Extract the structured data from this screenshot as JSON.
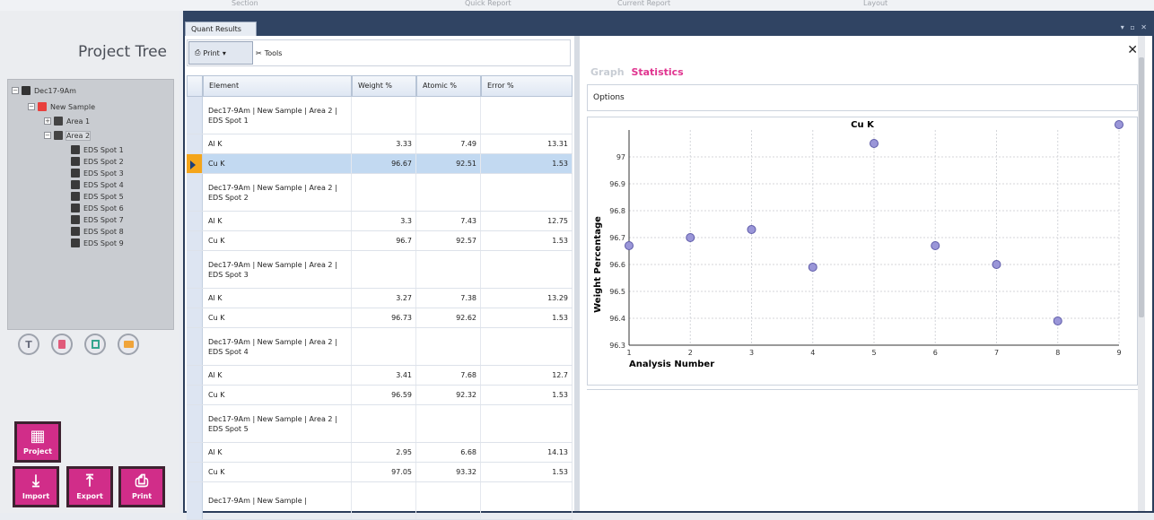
{
  "topbar": {
    "items": [
      "Section",
      "Quick Report",
      "Current Report",
      "Layout"
    ]
  },
  "left_panel": {
    "title": "Project Tree",
    "tree": {
      "root": "Dec17-9Am",
      "sample": "New Sample",
      "areas": [
        "Area 1",
        "Area 2"
      ],
      "spots": [
        "EDS Spot 1",
        "EDS Spot 2",
        "EDS Spot 3",
        "EDS Spot 4",
        "EDS Spot 5",
        "EDS Spot 6",
        "EDS Spot 7",
        "EDS Spot 8",
        "EDS Spot 9"
      ]
    },
    "circle_buttons": [
      "T",
      "trash-icon",
      "report-icon",
      "folder-icon"
    ],
    "buttons": {
      "project": "Project",
      "import": "Import",
      "export": "Export",
      "print": "Print"
    }
  },
  "window": {
    "tab": "Quant Results",
    "toolbar": {
      "print": "Print",
      "tools": "Tools"
    },
    "table": {
      "headers": [
        "Element",
        "Weight %",
        "Atomic %",
        "Error %"
      ],
      "rows": [
        {
          "type": "group",
          "label": "Dec17-9Am | New Sample | Area 2 | EDS Spot 1"
        },
        {
          "type": "data",
          "el": "Al K",
          "w": "3.33",
          "a": "7.49",
          "e": "13.31"
        },
        {
          "type": "data",
          "el": "Cu K",
          "w": "96.67",
          "a": "92.51",
          "e": "1.53",
          "selected": true
        },
        {
          "type": "group",
          "label": "Dec17-9Am | New Sample | Area 2 | EDS Spot 2"
        },
        {
          "type": "data",
          "el": "Al K",
          "w": "3.3",
          "a": "7.43",
          "e": "12.75"
        },
        {
          "type": "data",
          "el": "Cu K",
          "w": "96.7",
          "a": "92.57",
          "e": "1.53"
        },
        {
          "type": "group",
          "label": "Dec17-9Am | New Sample | Area 2 | EDS Spot 3"
        },
        {
          "type": "data",
          "el": "Al K",
          "w": "3.27",
          "a": "7.38",
          "e": "13.29"
        },
        {
          "type": "data",
          "el": "Cu K",
          "w": "96.73",
          "a": "92.62",
          "e": "1.53"
        },
        {
          "type": "group",
          "label": "Dec17-9Am | New Sample | Area 2 | EDS Spot 4"
        },
        {
          "type": "data",
          "el": "Al K",
          "w": "3.41",
          "a": "7.68",
          "e": "12.7"
        },
        {
          "type": "data",
          "el": "Cu K",
          "w": "96.59",
          "a": "92.32",
          "e": "1.53"
        },
        {
          "type": "group",
          "label": "Dec17-9Am | New Sample | Area 2 | EDS Spot 5"
        },
        {
          "type": "data",
          "el": "Al K",
          "w": "2.95",
          "a": "6.68",
          "e": "14.13"
        },
        {
          "type": "data",
          "el": "Cu K",
          "w": "97.05",
          "a": "93.32",
          "e": "1.53"
        },
        {
          "type": "group",
          "label": "Dec17-9Am | New Sample |"
        }
      ]
    },
    "right": {
      "tabs": {
        "graph": "Graph",
        "statistics": "Statistics"
      },
      "options": "Options"
    }
  },
  "chart_data": {
    "type": "scatter",
    "title": "Cu K",
    "xlabel": "Analysis Number",
    "ylabel": "Weight Percentage",
    "x": [
      1,
      2,
      3,
      4,
      5,
      6,
      7,
      8,
      9
    ],
    "y": [
      96.67,
      96.7,
      96.73,
      96.59,
      97.05,
      96.67,
      96.6,
      96.39,
      97.12
    ],
    "xlim": [
      1,
      9
    ],
    "ylim": [
      96.3,
      97.1
    ],
    "yticks": [
      96.3,
      96.4,
      96.5,
      96.6,
      96.7,
      96.8,
      96.9,
      97
    ],
    "grid": true,
    "marker_color": "#9a96d8"
  }
}
